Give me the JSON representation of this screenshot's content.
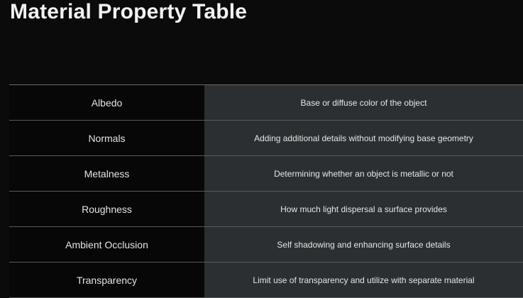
{
  "title": "Material Property Table",
  "rows": [
    {
      "property": "Albedo",
      "description": "Base or diffuse color of the object"
    },
    {
      "property": "Normals",
      "description": "Adding additional details without modifying base geometry"
    },
    {
      "property": "Metalness",
      "description": "Determining whether an object is metallic or not"
    },
    {
      "property": "Roughness",
      "description": "How much light dispersal a surface provides"
    },
    {
      "property": "Ambient Occlusion",
      "description": "Self shadowing and enhancing surface details"
    },
    {
      "property": "Transparency",
      "description": "Limit use of transparency and utilize with separate material"
    }
  ],
  "colors": {
    "background": "#0b0b0b",
    "left_column": "#070707",
    "right_column": "#2b2f31",
    "divider": "#5a5a5a"
  }
}
